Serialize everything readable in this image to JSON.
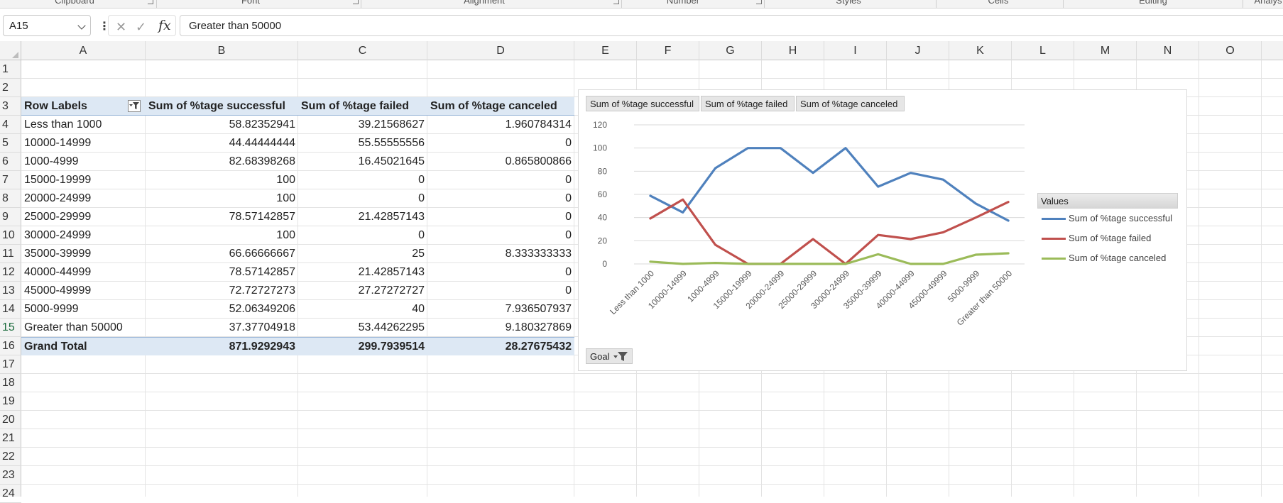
{
  "ribbon": {
    "groups": [
      {
        "name": "clipboard",
        "label": "Clipboard",
        "center": 105
      },
      {
        "name": "font",
        "label": "Font",
        "center": 353
      },
      {
        "name": "alignment",
        "label": "Alignment",
        "center": 682
      },
      {
        "name": "number",
        "label": "Number",
        "center": 962
      },
      {
        "name": "styles",
        "label": "Styles",
        "center": 1195
      },
      {
        "name": "cells",
        "label": "Cells",
        "center": 1406
      },
      {
        "name": "editing",
        "label": "Editing",
        "center": 1624
      },
      {
        "name": "analysis",
        "label": "Analys",
        "center": 1786
      }
    ],
    "launchers_x": [
      208,
      497,
      864,
      1065
    ],
    "separators_x": [
      220,
      508,
      875,
      1076,
      1318,
      1497,
      1750
    ]
  },
  "formula_bar": {
    "name_box": "A15",
    "formula": "Greater than 50000",
    "fx_label": "fx"
  },
  "columns": [
    "A",
    "B",
    "C",
    "D",
    "E",
    "F",
    "G",
    "H",
    "I",
    "J",
    "K",
    "L",
    "M",
    "N",
    "O"
  ],
  "rows": [
    "1",
    "2",
    "3",
    "4",
    "5",
    "6",
    "7",
    "8",
    "9",
    "10",
    "11",
    "12",
    "13",
    "14",
    "15",
    "16",
    "17",
    "18",
    "19",
    "20",
    "21",
    "22",
    "23",
    "24"
  ],
  "pivot": {
    "headers": [
      "Row Labels",
      "Sum of %tage successful",
      "Sum of %tage failed",
      "Sum of %tage canceled"
    ],
    "rows": [
      {
        "label": "Less than 1000",
        "successful": "58.82352941",
        "failed": "39.21568627",
        "canceled": "1.960784314"
      },
      {
        "label": "10000-14999",
        "successful": "44.44444444",
        "failed": "55.55555556",
        "canceled": "0"
      },
      {
        "label": "1000-4999",
        "successful": "82.68398268",
        "failed": "16.45021645",
        "canceled": "0.865800866"
      },
      {
        "label": "15000-19999",
        "successful": "100",
        "failed": "0",
        "canceled": "0"
      },
      {
        "label": "20000-24999",
        "successful": "100",
        "failed": "0",
        "canceled": "0"
      },
      {
        "label": "25000-29999",
        "successful": "78.57142857",
        "failed": "21.42857143",
        "canceled": "0"
      },
      {
        "label": "30000-24999",
        "successful": "100",
        "failed": "0",
        "canceled": "0"
      },
      {
        "label": "35000-39999",
        "successful": "66.66666667",
        "failed": "25",
        "canceled": "8.333333333"
      },
      {
        "label": "40000-44999",
        "successful": "78.57142857",
        "failed": "21.42857143",
        "canceled": "0"
      },
      {
        "label": "45000-49999",
        "successful": "72.72727273",
        "failed": "27.27272727",
        "canceled": "0"
      },
      {
        "label": "5000-9999",
        "successful": "52.06349206",
        "failed": "40",
        "canceled": "7.936507937"
      },
      {
        "label": "Greater than 50000",
        "successful": "37.37704918",
        "failed": "53.44262295",
        "canceled": "9.180327869"
      }
    ],
    "total": {
      "label": "Grand Total",
      "successful": "871.9292943",
      "failed": "299.7939514",
      "canceled": "28.27675432"
    }
  },
  "chart_data": {
    "type": "line",
    "title": "",
    "xlabel": "",
    "ylabel": "",
    "ylim": [
      0,
      120
    ],
    "yticks": [
      0,
      20,
      40,
      60,
      80,
      100,
      120
    ],
    "grid": true,
    "legend_position": "right",
    "legend_title": "Values",
    "value_field_buttons": [
      "Sum of %tage successful",
      "Sum of %tage failed",
      "Sum of %tage canceled"
    ],
    "axis_field_button": "Goal",
    "categories": [
      "Less than 1000",
      "10000-14999",
      "1000-4999",
      "15000-19999",
      "20000-24999",
      "25000-29999",
      "30000-24999",
      "35000-39999",
      "40000-44999",
      "45000-49999",
      "5000-9999",
      "Greater than 50000"
    ],
    "series": [
      {
        "name": "Sum of %tage successful",
        "color": "#4f81bd",
        "values": [
          58.82,
          44.44,
          82.68,
          100,
          100,
          78.57,
          100,
          66.67,
          78.57,
          72.73,
          52.06,
          37.38
        ]
      },
      {
        "name": "Sum of %tage failed",
        "color": "#c0504d",
        "values": [
          39.22,
          55.56,
          16.45,
          0,
          0,
          21.43,
          0,
          25,
          21.43,
          27.27,
          40,
          53.44
        ]
      },
      {
        "name": "Sum of %tage canceled",
        "color": "#9bbb59",
        "values": [
          1.96,
          0,
          0.87,
          0,
          0,
          0,
          0,
          8.33,
          0,
          0,
          7.94,
          9.18
        ]
      }
    ]
  }
}
